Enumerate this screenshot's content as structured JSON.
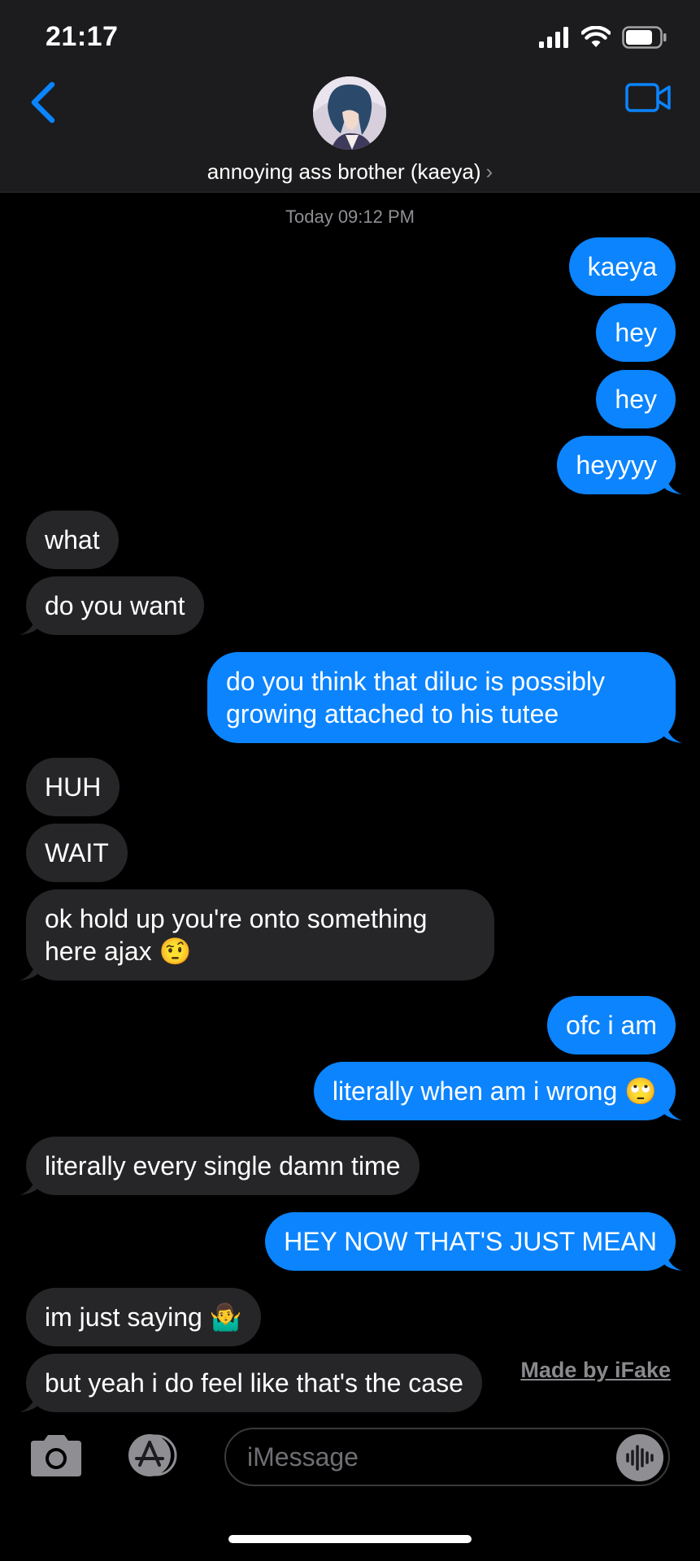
{
  "status_bar": {
    "time": "21:17"
  },
  "header": {
    "contact_name": "annoying ass brother (kaeya)",
    "chevron": "›",
    "back_icon": "chevron-left-icon",
    "video_icon": "video-camera-icon"
  },
  "timestamp": "Today 09:12 PM",
  "messages": [
    {
      "text": "kaeya",
      "side": "out"
    },
    {
      "text": "hey",
      "side": "out"
    },
    {
      "text": "hey",
      "side": "out"
    },
    {
      "text": "heyyyy",
      "side": "out"
    },
    {
      "text": "what",
      "side": "in"
    },
    {
      "text": "do you want",
      "side": "in"
    },
    {
      "text": "do you think that diluc is possibly growing attached to his tutee",
      "side": "out"
    },
    {
      "text": "HUH",
      "side": "in"
    },
    {
      "text": "WAIT",
      "side": "in"
    },
    {
      "text": "ok hold up you're onto something here ajax 🤨",
      "side": "in"
    },
    {
      "text": "ofc i am",
      "side": "out"
    },
    {
      "text": "literally when am i wrong 🙄",
      "side": "out"
    },
    {
      "text": "literally every single damn time",
      "side": "in"
    },
    {
      "text": "HEY NOW THAT'S JUST MEAN",
      "side": "out"
    },
    {
      "text": "im just saying 🤷‍♂️",
      "side": "in"
    },
    {
      "text": "but yeah i do feel like that's the case",
      "side": "in"
    }
  ],
  "watermark": "Made by iFake",
  "input_bar": {
    "placeholder": "iMessage",
    "camera_icon": "camera-icon",
    "appstore_icon": "app-store-icon",
    "audio_icon": "audio-waveform-icon"
  },
  "colors": {
    "outgoing_bubble": "#0b84fe",
    "incoming_bubble": "#262628",
    "accent": "#0a84ff",
    "header_bg": "#1c1c1e"
  }
}
